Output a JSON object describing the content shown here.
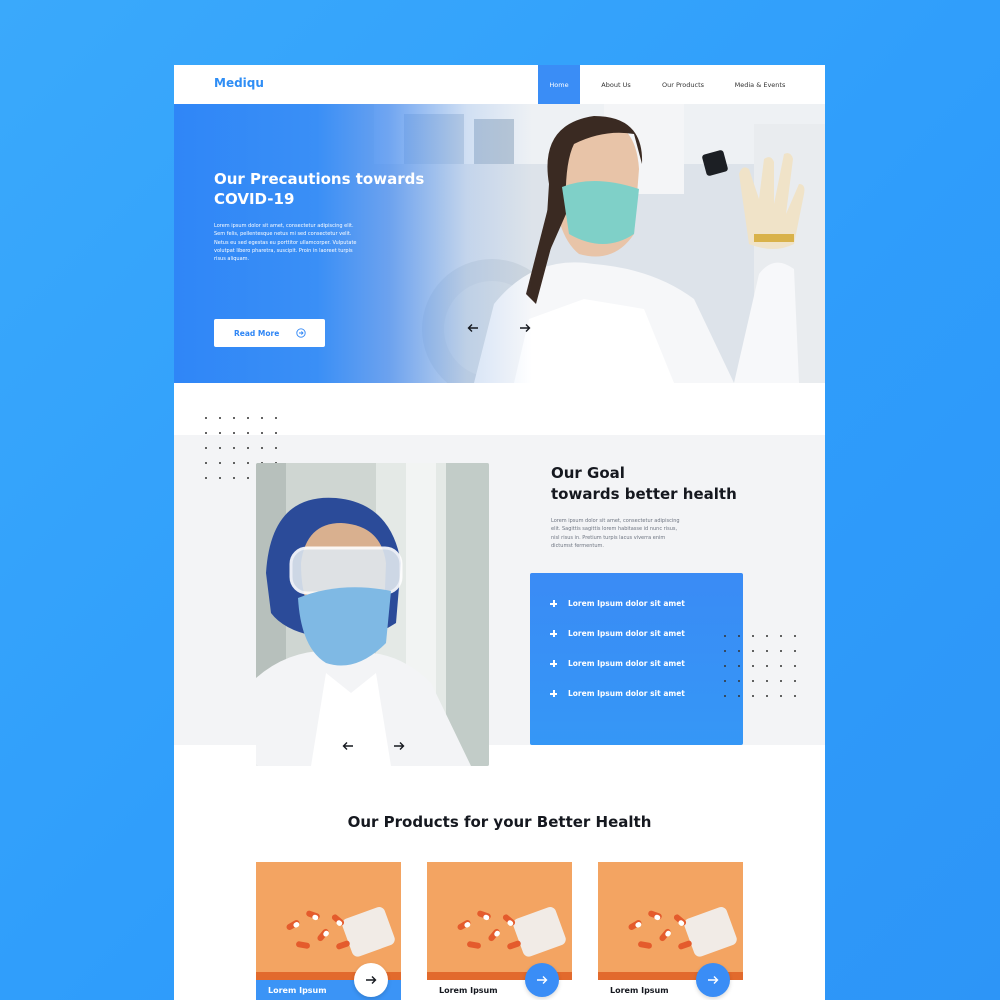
{
  "brand": "Mediqu",
  "nav": {
    "items": [
      {
        "label": "Home",
        "active": true
      },
      {
        "label": "About Us",
        "active": false
      },
      {
        "label": "Our Products",
        "active": false
      },
      {
        "label": "Media & Events",
        "active": false
      }
    ]
  },
  "hero": {
    "title": "Our Precautions towards COVID-19",
    "text": "Lorem ipsum dolor sit amet, consectetur adipiscing elit. Sem felis, pellentesque netus mi sed consectetur velit. Netus eu sed egestas eu porttitor ullamcorper. Vulputate volutpat libero pharetra, suscipit. Proin in laoreet turpis risus aliquam.",
    "read_more": "Read More",
    "prev_icon": "arrow-left-icon",
    "next_icon": "arrow-right-icon"
  },
  "goal": {
    "title_line1": "Our Goal",
    "title_line2": "towards better health",
    "text": "Lorem ipsum dolor sit amet, consectetur adipiscing elit. Sagittis sagittis lorem habitasse id nunc risus, nisl risus in. Pretium turpis lacus viverra enim dictumst fermentum.",
    "items": [
      "Lorem Ipsum dolor sit amet",
      "Lorem Ipsum dolor sit amet",
      "Lorem Ipsum dolor sit amet",
      "Lorem Ipsum dolor sit amet"
    ]
  },
  "products": {
    "title": "Our Products for your Better Health",
    "items": [
      {
        "label": "Lorem Ipsum"
      },
      {
        "label": "Lorem Ipsum"
      },
      {
        "label": "Lorem Ipsum"
      }
    ]
  },
  "colors": {
    "primary": "#3a8df6",
    "background": "#35a3fb",
    "dark_text": "#15181f"
  }
}
